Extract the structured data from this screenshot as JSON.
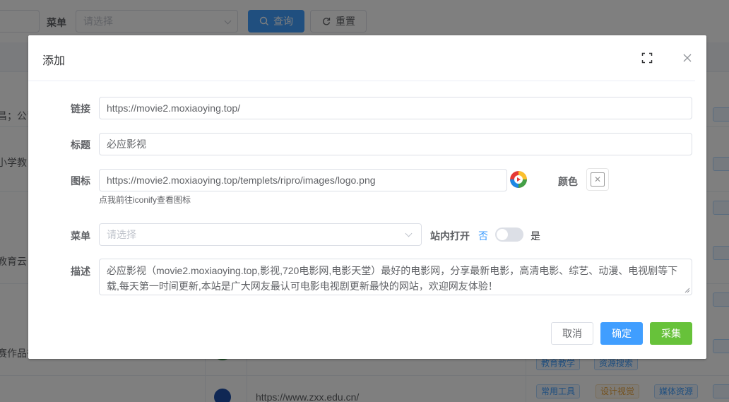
{
  "background": {
    "filter_label": "菜单",
    "select_placeholder": "请选择",
    "search_button": "查询",
    "reset_button": "重置",
    "row_snippets": [
      "昌；公司",
      "小学教",
      "教育云",
      "赛作品征"
    ],
    "last_row_url": "https://www.zxx.edu.cn/",
    "tags_row_a": [
      "教育教学",
      "资源搜索"
    ],
    "tags_row_b": [
      "常用工具",
      "设计视觉",
      "媒体资源"
    ]
  },
  "dialog": {
    "title": "添加",
    "fields": {
      "link_label": "链接",
      "link_value": "https://movie2.moxiaoying.top/",
      "title_label": "标题",
      "title_value": "必应影视",
      "icon_label": "图标",
      "icon_value": "https://movie2.moxiaoying.top/templets/ripro/images/logo.png",
      "icon_hint": "点我前往iconify查看图标",
      "color_label": "颜色",
      "menu_label": "菜单",
      "menu_placeholder": "请选择",
      "open_inside_label": "站内打开",
      "switch_off_text": "否",
      "switch_on_text": "是",
      "switch_on": false,
      "desc_label": "描述",
      "desc_value": "必应影视（movie2.moxiaoying.top,影视,720电影网,电影天堂）最好的电影网，分享最新电影，高清电影、综艺、动漫、电视剧等下载,每天第一时间更新,本站是广大网友最认可电影电视剧更新最快的网站，欢迎网友体验！"
    },
    "buttons": {
      "cancel": "取消",
      "confirm": "确定",
      "collect": "采集"
    }
  },
  "colors": {
    "primary": "#409eff",
    "success": "#67c23a",
    "mask": "rgba(0,0,0,0.5)"
  },
  "icons": [
    "search-icon",
    "refresh-icon",
    "fullscreen-icon",
    "close-icon",
    "site-logo-icon",
    "color-picker-empty-icon",
    "chevron-down-icon"
  ]
}
